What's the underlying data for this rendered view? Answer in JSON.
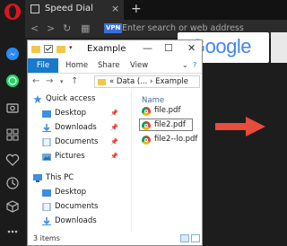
{
  "browser": {
    "tab_title": "Speed Dial",
    "tab_close": "×",
    "new_tab": "+",
    "vpn_label": "VPN",
    "address_placeholder": "Enter search or web address"
  },
  "speed_dial": {
    "search_logo": "Google"
  },
  "explorer": {
    "window_title": "Example",
    "ribbon_tabs": [
      "File",
      "Home",
      "Share",
      "View"
    ],
    "path": "«  Data (...  ›  Example",
    "nav": {
      "quick_access": "Quick access",
      "quick_items": [
        "Desktop",
        "Downloads",
        "Documents",
        "Pictures"
      ],
      "this_pc": "This PC",
      "pc_items": [
        "Desktop",
        "Documents",
        "Downloads"
      ]
    },
    "column_header": "Name",
    "files": [
      "file.pdf",
      "file2.pdf",
      "file2--lo.pdf"
    ],
    "status": "3 items"
  },
  "colors": {
    "opera_red": "#e0141e",
    "file_tab_blue": "#1979ca",
    "arrow_red": "#e74c3c",
    "folder_yellow": "#f4c64e"
  }
}
